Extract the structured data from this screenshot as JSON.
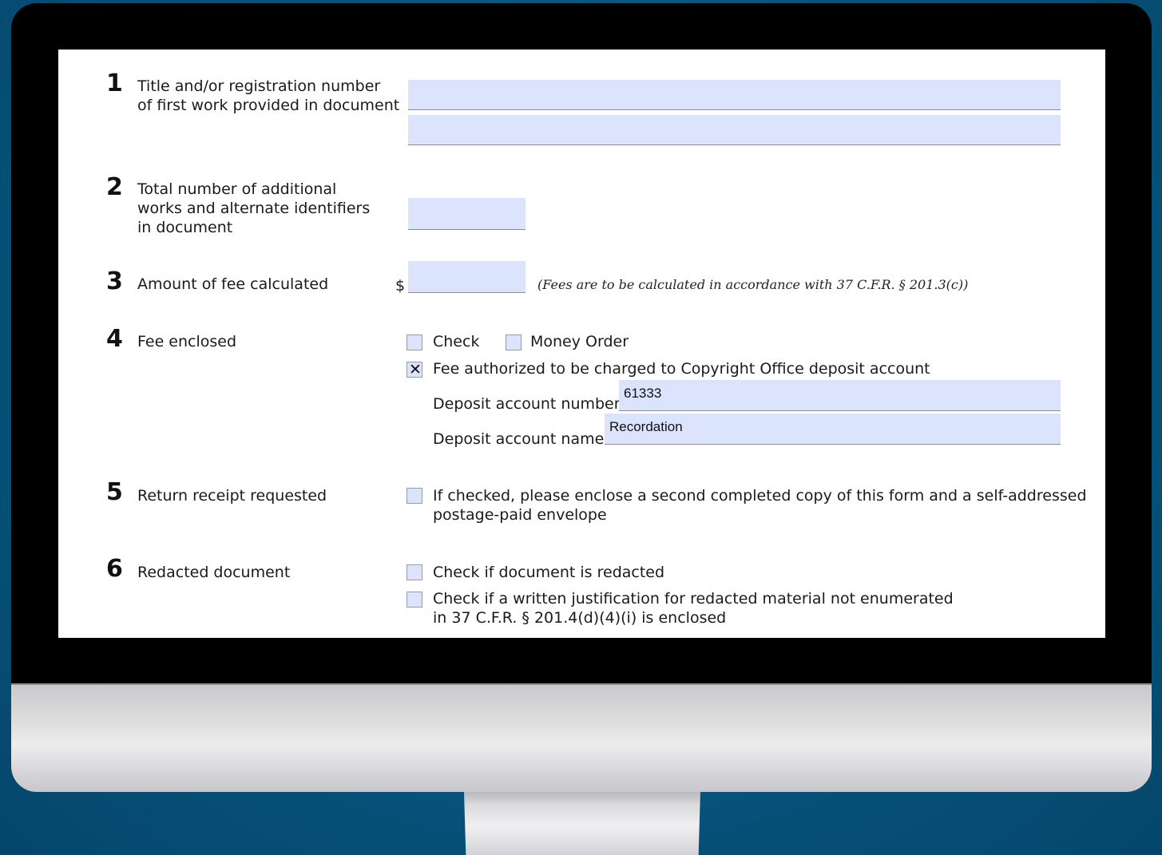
{
  "items": [
    {
      "number": "1",
      "label_lines": [
        "Title and/or registration number",
        "of first work provided in document"
      ]
    },
    {
      "number": "2",
      "label_lines": [
        "Total number of additional",
        "works and alternate identifiers",
        "in document"
      ]
    },
    {
      "number": "3",
      "label": "Amount of fee calculated",
      "currency": "$",
      "note": "(Fees are to be calculated in accordance with 37 C.F.R. § 201.3(c))"
    },
    {
      "number": "4",
      "label": "Fee enclosed",
      "options": {
        "check": "Check",
        "money_order": "Money Order",
        "deposit": "Fee authorized to be charged to Copyright Office deposit account"
      },
      "deposit_account_number_label": "Deposit account number",
      "deposit_account_number_value": "61333",
      "deposit_account_name_label": "Deposit account name",
      "deposit_account_name_value": "Recordation",
      "checked_mark": "✕"
    },
    {
      "number": "5",
      "label": "Return receipt requested",
      "option_lines": [
        "If checked, please enclose a second completed copy of this form and a self-addressed",
        "postage-paid envelope"
      ]
    },
    {
      "number": "6",
      "label": "Redacted document",
      "option_redacted": "Check if document is redacted",
      "option_justification_lines": [
        "Check if a written justification for redacted material not enumerated",
        "in 37 C.F.R. § 201.4(d)(4)(i) is enclosed"
      ]
    }
  ],
  "checkbox_states": {
    "check": false,
    "money_order": false,
    "deposit": true,
    "return_receipt": false,
    "redacted": false,
    "justification": false
  },
  "colors": {
    "field_fill": "#dce3fd",
    "background": "#07557f"
  }
}
